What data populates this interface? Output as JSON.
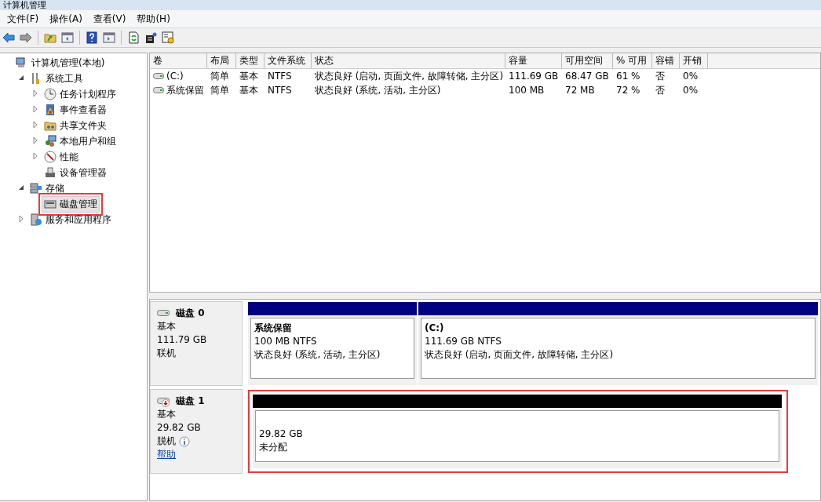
{
  "window": {
    "title": "计算机管理"
  },
  "menu": [
    "文件(F)",
    "操作(A)",
    "查看(V)",
    "帮助(H)"
  ],
  "tree": [
    {
      "label": "计算机管理(本地)",
      "selected": false,
      "highlighted": false,
      "children": [
        {
          "label": "系统工具",
          "expanded": true,
          "selected": false,
          "highlighted": false,
          "children": [
            {
              "label": "任务计划程序",
              "expanded": false,
              "selected": false,
              "highlighted": false
            },
            {
              "label": "事件查看器",
              "expanded": false,
              "selected": false,
              "highlighted": false
            },
            {
              "label": "共享文件夹",
              "expanded": false,
              "selected": false,
              "highlighted": false
            },
            {
              "label": "本地用户和组",
              "expanded": false,
              "selected": false,
              "highlighted": false
            },
            {
              "label": "性能",
              "expanded": false,
              "selected": false,
              "highlighted": false
            },
            {
              "label": "设备管理器",
              "selected": false,
              "highlighted": false
            }
          ]
        },
        {
          "label": "存储",
          "expanded": true,
          "selected": false,
          "highlighted": false,
          "children": [
            {
              "label": "磁盘管理",
              "selected": true,
              "highlighted": true
            }
          ]
        },
        {
          "label": "服务和应用程序",
          "expanded": false,
          "selected": false,
          "highlighted": false
        }
      ]
    }
  ],
  "table": {
    "columns": [
      "卷",
      "布局",
      "类型",
      "文件系统",
      "状态",
      "容量",
      "可用空间",
      "% 可用",
      "容错",
      "开销"
    ],
    "rows": [
      [
        "(C:)",
        "简单",
        "基本",
        "NTFS",
        "状态良好 (启动, 页面文件, 故障转储, 主分区)",
        "111.69 GB",
        "68.47 GB",
        "61 %",
        "否",
        "0%"
      ],
      [
        "系统保留",
        "简单",
        "基本",
        "NTFS",
        "状态良好 (系统, 活动, 主分区)",
        "100 MB",
        "72 MB",
        "72 %",
        "否",
        "0%"
      ]
    ]
  },
  "disks": [
    {
      "name": "磁盘 0",
      "type": "基本",
      "size": "111.79 GB",
      "status": "联机",
      "online": true,
      "highlighted": false,
      "partitions": [
        {
          "kind": "primary",
          "name": "系统保留",
          "size": "100 MB NTFS",
          "status": "状态良好 (系统, 活动, 主分区)"
        },
        {
          "kind": "primary",
          "name": "(C:)",
          "size": "111.69 GB NTFS",
          "status": "状态良好 (启动, 页面文件, 故障转储, 主分区)"
        }
      ]
    },
    {
      "name": "磁盘 1",
      "type": "基本",
      "size": "29.82 GB",
      "status": "脱机",
      "online": false,
      "help": "帮助",
      "highlighted": true,
      "partitions": [
        {
          "kind": "unallocated",
          "size": "29.82 GB",
          "status": "未分配"
        }
      ]
    }
  ]
}
